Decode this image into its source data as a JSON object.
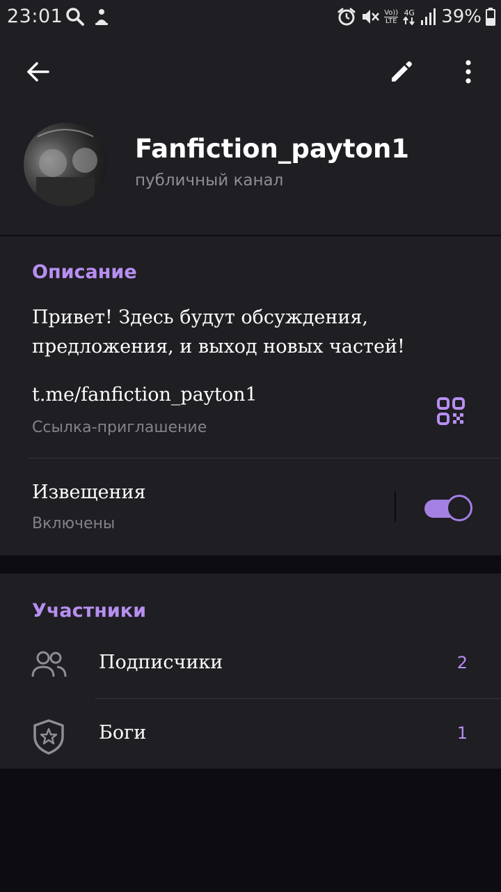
{
  "status_bar": {
    "time": "23:01",
    "battery_percent": "39%",
    "network": "4G",
    "volte_top": "Vo))",
    "volte_bottom": "LTE",
    "icons": [
      "search-icon",
      "notification-icon",
      "alarm-icon",
      "mute-icon",
      "volte-icon",
      "data-icon",
      "signal-icon",
      "battery-icon"
    ]
  },
  "toolbar": {
    "icons": [
      "back-arrow-icon",
      "edit-pencil-icon",
      "more-vert-icon"
    ]
  },
  "channel": {
    "name": "Fanfiction_payton1",
    "type": "публичный канал"
  },
  "info_section": {
    "title": "Описание",
    "description": "Привет! Здесь будут обсуждения, предложения, и выход новых частей!",
    "link": "t.me/fanfiction_payton1",
    "link_caption": "Ссылка-приглашение",
    "notifications_label": "Извещения",
    "notifications_state": "Включены",
    "notifications_enabled": true
  },
  "members_section": {
    "title": "Участники",
    "rows": [
      {
        "label": "Подписчики",
        "count": "2",
        "icon": "people-icon"
      },
      {
        "label": "Боги",
        "count": "1",
        "icon": "shield-star-icon"
      }
    ]
  },
  "colors": {
    "accent": "#b78ff0",
    "toggle": "#a580e3",
    "surface": "#1f1e23",
    "background": "#0d0c10",
    "secondary_text": "#84828a"
  }
}
